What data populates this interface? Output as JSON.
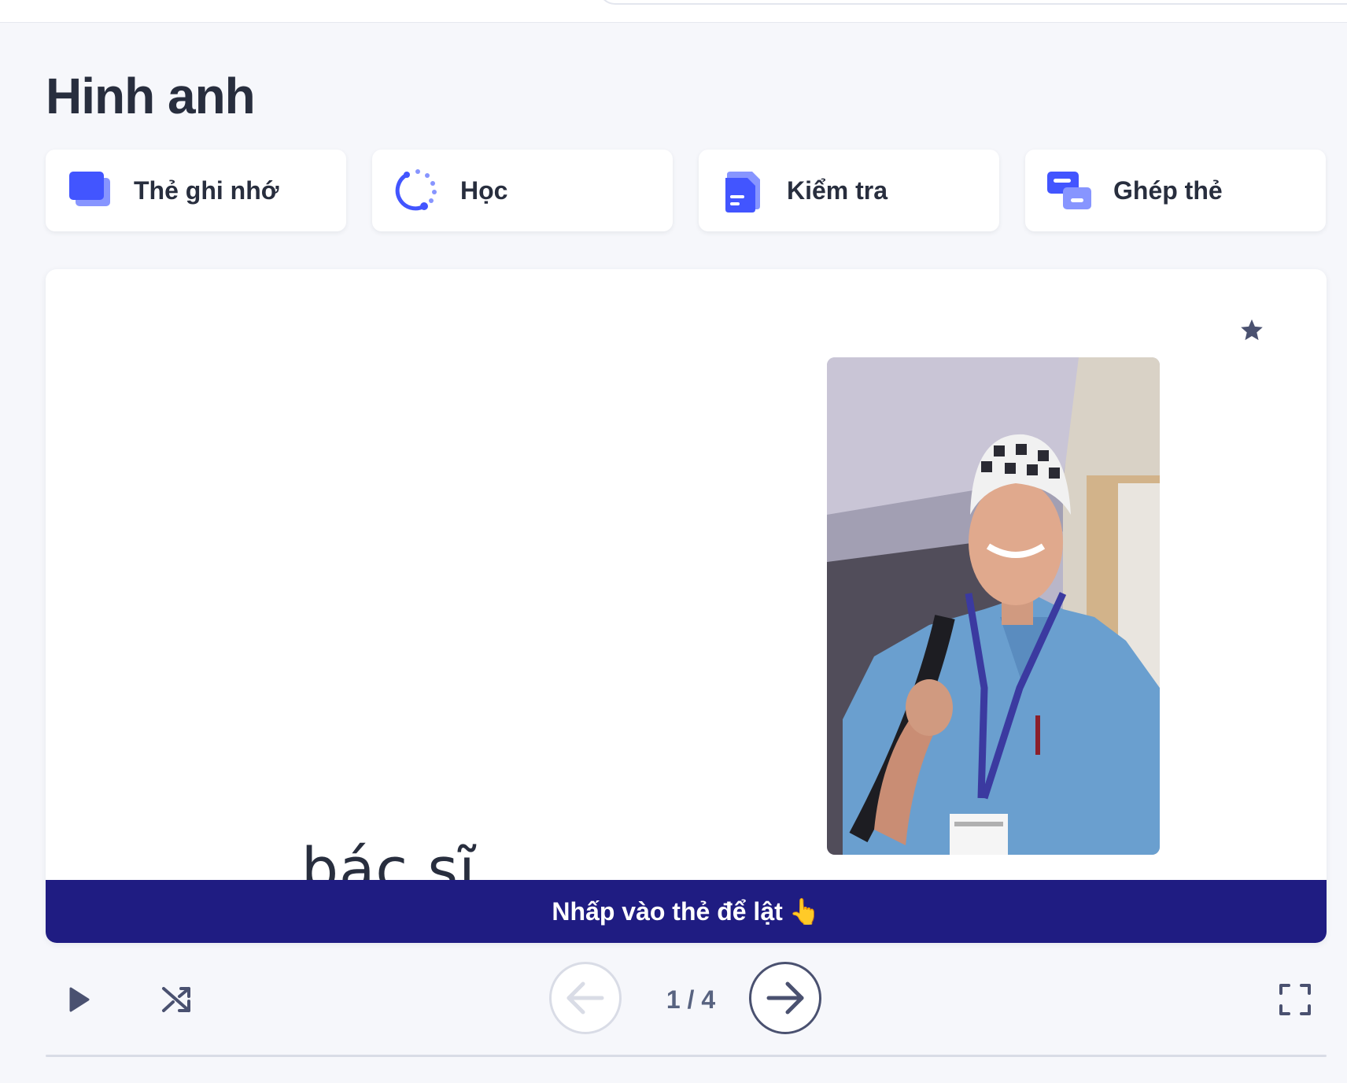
{
  "page": {
    "title": "Hinh anh"
  },
  "modes": [
    {
      "label": "Thẻ ghi nhớ",
      "icon": "flashcards-icon"
    },
    {
      "label": "Học",
      "icon": "learn-icon"
    },
    {
      "label": "Kiểm tra",
      "icon": "test-icon"
    },
    {
      "label": "Ghép thẻ",
      "icon": "match-icon"
    }
  ],
  "card": {
    "term": "bác sĩ",
    "image": "doctor-photo",
    "flip_hint": "Nhấp vào thẻ để lật",
    "flip_hint_emoji": "👆",
    "starred": false
  },
  "controls": {
    "counter": "1 / 4",
    "prev_enabled": false,
    "next_enabled": true
  },
  "colors": {
    "accent": "#4255ff",
    "banner": "#1f1c82",
    "text": "#282e3e",
    "muted": "#586380",
    "background": "#f6f7fb"
  }
}
